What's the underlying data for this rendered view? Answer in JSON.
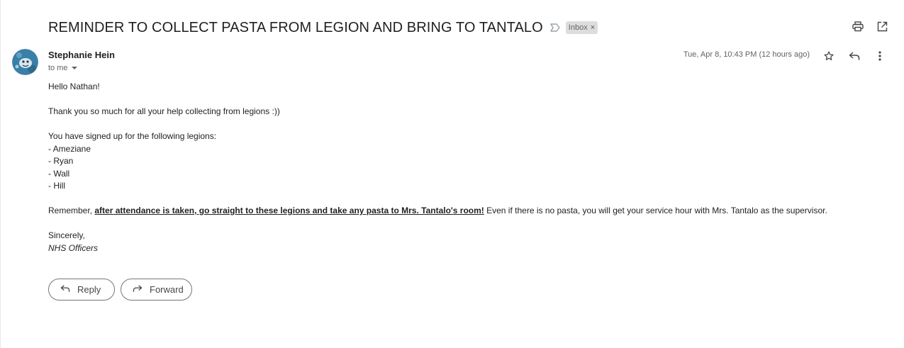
{
  "email": {
    "subject": "REMINDER TO COLLECT PASTA FROM LEGION AND BRING TO TANTALO",
    "label": "Inbox",
    "label_remove": "×",
    "sender": "Stephanie Hein",
    "to_text": "to me",
    "date": "Tue, Apr 8, 10:43 PM (12 hours ago)",
    "body": {
      "greeting": "Hello Nathan!",
      "thanks": "Thank you so much for all your help collecting from legions :))",
      "intro": "You have signed up for the following legions:",
      "legions": [
        "- Ameziane",
        "- Ryan",
        "- Wall",
        "- Hill"
      ],
      "reminder_prefix": "Remember, ",
      "reminder_emphasis": "after attendance is taken, go straight to these legions and take any pasta to Mrs. Tantalo's room!",
      "reminder_suffix": " Even if there is no pasta, you will get your service hour with Mrs. Tantalo as the supervisor.",
      "closing": "Sincerely,",
      "signature": "NHS Officers"
    }
  },
  "actions": {
    "reply_label": "Reply",
    "forward_label": "Forward"
  },
  "icons": {
    "importance": "importance-marker-icon",
    "print": "print-icon",
    "open_new_window": "open-in-new-window-icon",
    "star": "star-icon",
    "reply": "reply-icon",
    "more": "more-vertical-icon",
    "dropdown": "caret-down-icon",
    "forward": "forward-icon"
  },
  "colors": {
    "text": "#202124",
    "muted": "#5f6368",
    "chip_bg": "#dddddd",
    "avatar": "#3a7fa8"
  }
}
